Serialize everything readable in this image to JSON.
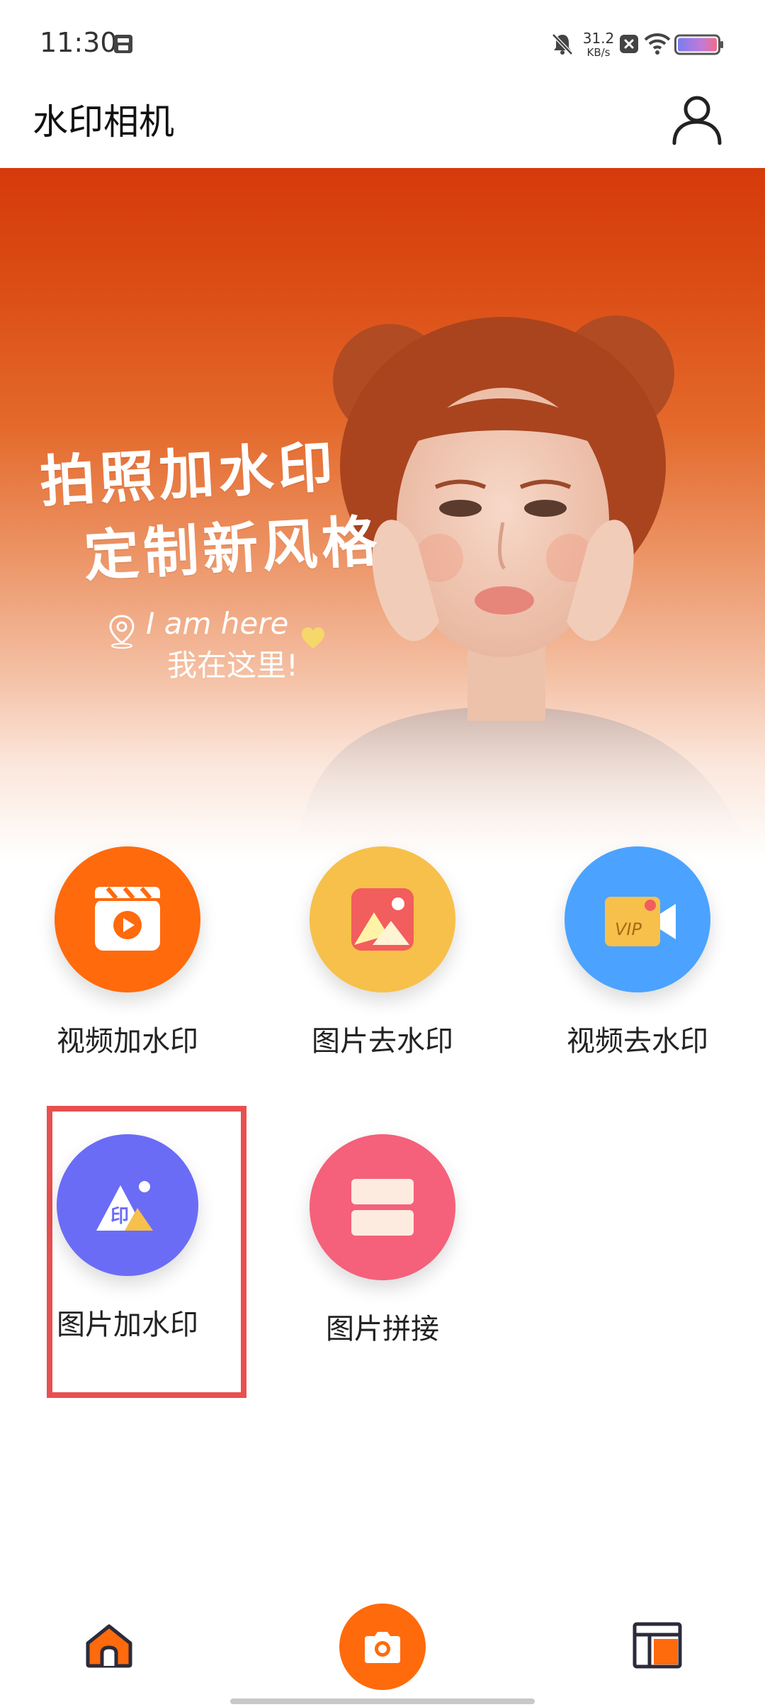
{
  "status_bar": {
    "time": "11:30",
    "net_speed_value": "31.2",
    "net_speed_unit": "KB/s"
  },
  "header": {
    "title": "水印相机",
    "user_icon": "user-icon"
  },
  "banner": {
    "headline_line1": "拍照加水印",
    "headline_line2": "定制新风格",
    "tagline_en": "I am here",
    "tagline_cn": "我在这里!",
    "accent_color": "#d53a0b"
  },
  "features": [
    {
      "label": "视频加水印",
      "icon": "video-clapper-icon",
      "color": "#ff6a0c"
    },
    {
      "label": "图片去水印",
      "icon": "image-icon",
      "color": "#f7c04a"
    },
    {
      "label": "视频去水印",
      "icon": "vip-video-camera-icon",
      "color": "#4ba3ff"
    },
    {
      "label": "图片加水印",
      "icon": "watermark-image-icon",
      "color": "#6b6cf6"
    },
    {
      "label": "图片拼接",
      "icon": "collage-icon",
      "color": "#f5607a"
    }
  ],
  "bottom_nav": {
    "home_icon": "home-icon",
    "camera_icon": "camera-icon",
    "grid_icon": "layout-icon",
    "accent": "#ff6a0c"
  }
}
